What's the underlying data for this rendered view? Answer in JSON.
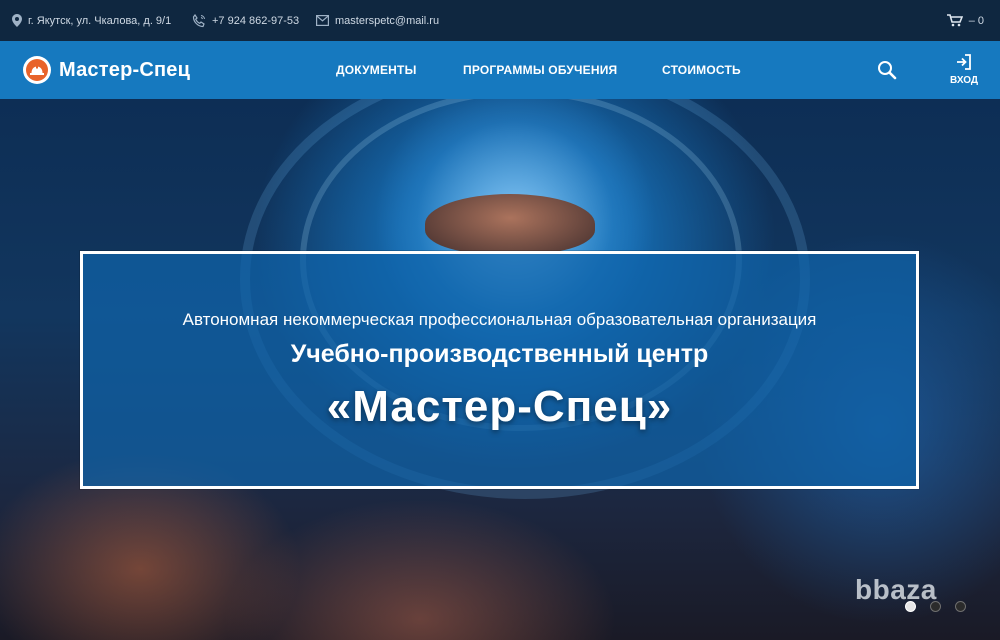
{
  "topbar": {
    "address": "г. Якутск, ул. Чкалова, д. 9/1",
    "phone": "+7 924 862-97-53",
    "email": "masterspetc@mail.ru",
    "cart_count": "– 0",
    "icons": {
      "address": "map-pin-icon",
      "phone": "phone-icon",
      "email": "envelope-icon",
      "cart": "cart-icon"
    }
  },
  "nav": {
    "logo_text": "Мастер-Спец",
    "menu": [
      "ДОКУМЕНТЫ",
      "ПРОГРАММЫ ОБУЧЕНИЯ",
      "СТОИМОСТЬ"
    ],
    "login_label": "ВХОД",
    "icons": {
      "search": "search-icon",
      "login": "login-icon",
      "logo": "hard-hat-icon"
    }
  },
  "hero": {
    "subtitle": "Автономная некоммерческая профессиональная образовательная организация",
    "line2": "Учебно-производственный центр",
    "title": "«Мастер-Спец»",
    "slides_total": 3,
    "active_slide": 1
  },
  "watermark": "bbaza",
  "colors": {
    "topbar_bg": "#0f2740",
    "nav_bg": "#1679bf",
    "hero_box_bg": "#0f64aa",
    "logo_accent": "#e8632a"
  }
}
